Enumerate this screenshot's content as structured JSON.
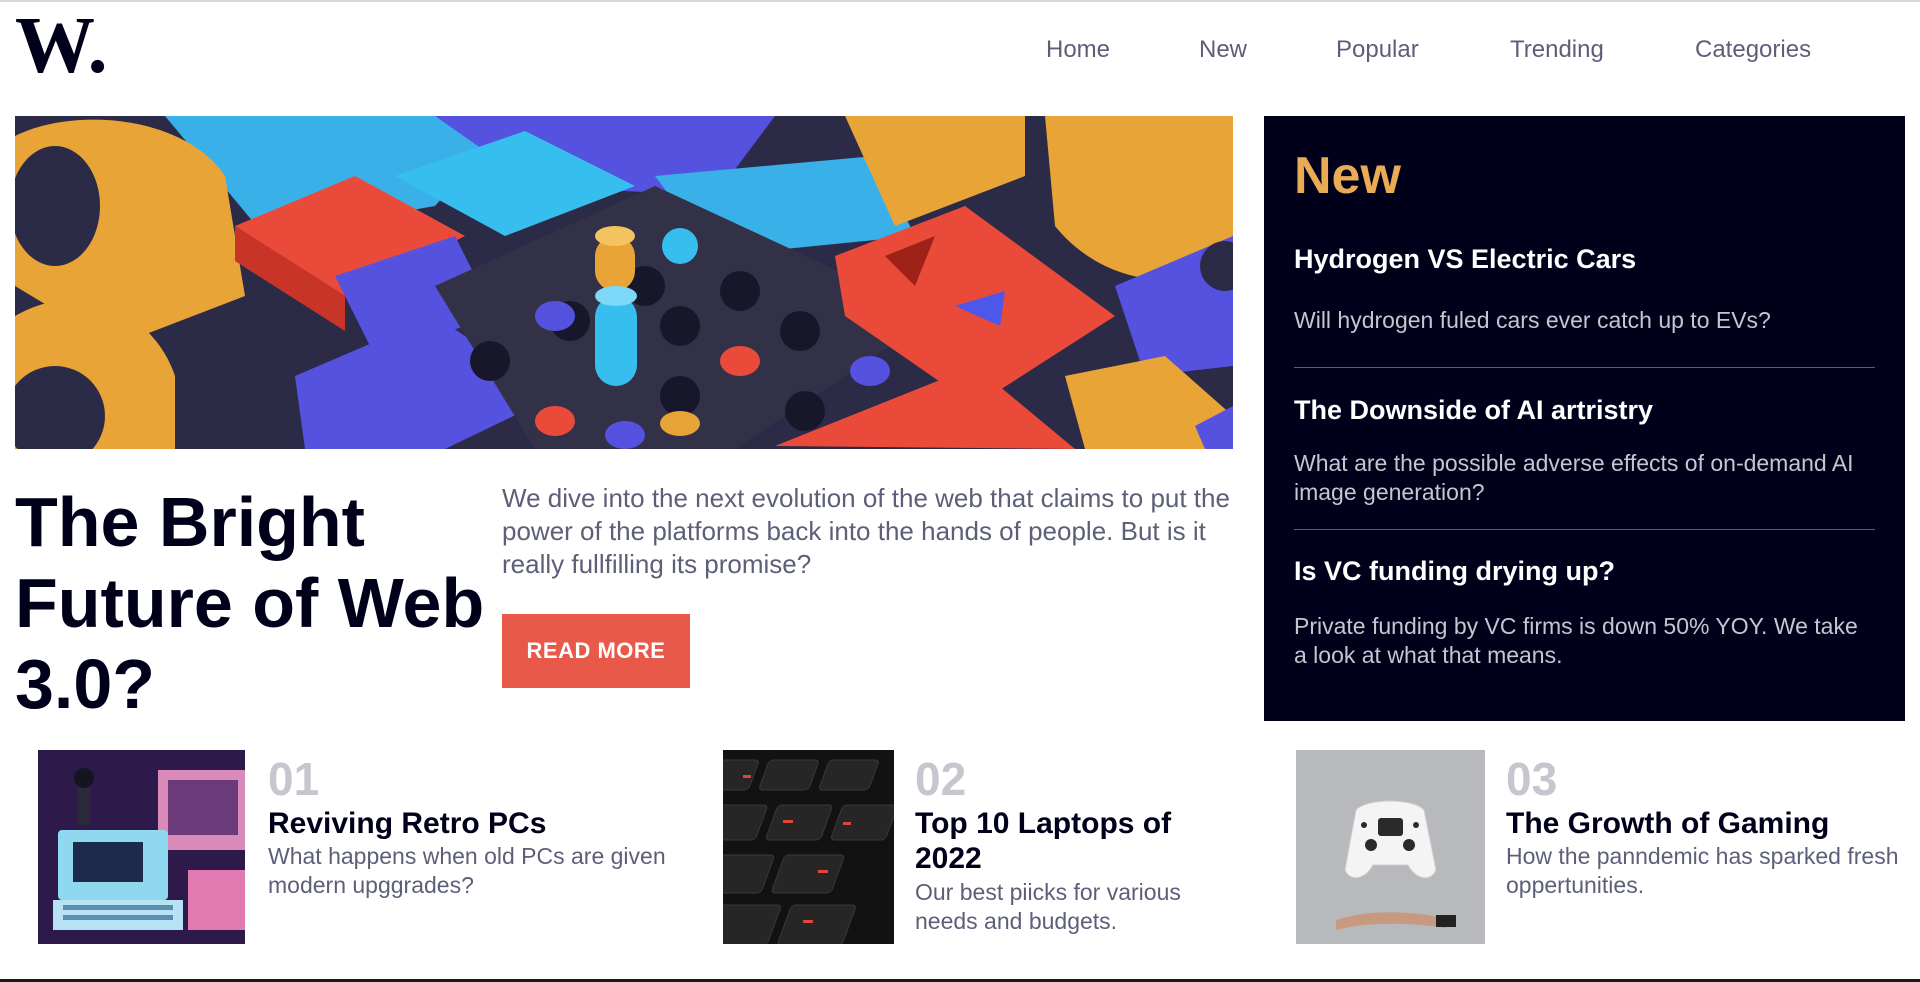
{
  "header": {
    "logo_text": "W.",
    "nav": [
      "Home",
      "New",
      "Popular",
      "Trending",
      "Categories"
    ]
  },
  "hero": {
    "title": "The Bright Future of Web 3.0?",
    "description": "We dive into the next evolution of the web that claims to put the power of the platforms back into the hands of people. But is it really fullfilling its promise?",
    "button_label": "READ MORE"
  },
  "sidebar": {
    "title": "New",
    "items": [
      {
        "title": "Hydrogen VS Electric Cars",
        "description": "Will hydrogen fuled cars ever catch up to EVs?"
      },
      {
        "title": "The Downside of AI artristry",
        "description": "What are the possible adverse effects of on-demand AI image generation?"
      },
      {
        "title": "Is VC funding drying up?",
        "description": "Private funding by VC firms is down 50% YOY. We take a look at what that means."
      }
    ]
  },
  "articles": [
    {
      "number": "01",
      "title": "Reviving Retro PCs",
      "description": "What happens when old PCs are given modern upggrades?"
    },
    {
      "number": "02",
      "title": "Top 10 Laptops of 2022",
      "description": "Our best piicks for various needs and budgets."
    },
    {
      "number": "03",
      "title": "The Growth of Gaming",
      "description": "How the panndemic has sparked fresh oppertunities."
    }
  ],
  "colors": {
    "dark_navy": "#00001a",
    "accent_red": "#e9594a",
    "accent_orange": "#e9ab53",
    "grayish_blue": "#5d5f79",
    "light_gray": "#c5c6ce"
  }
}
